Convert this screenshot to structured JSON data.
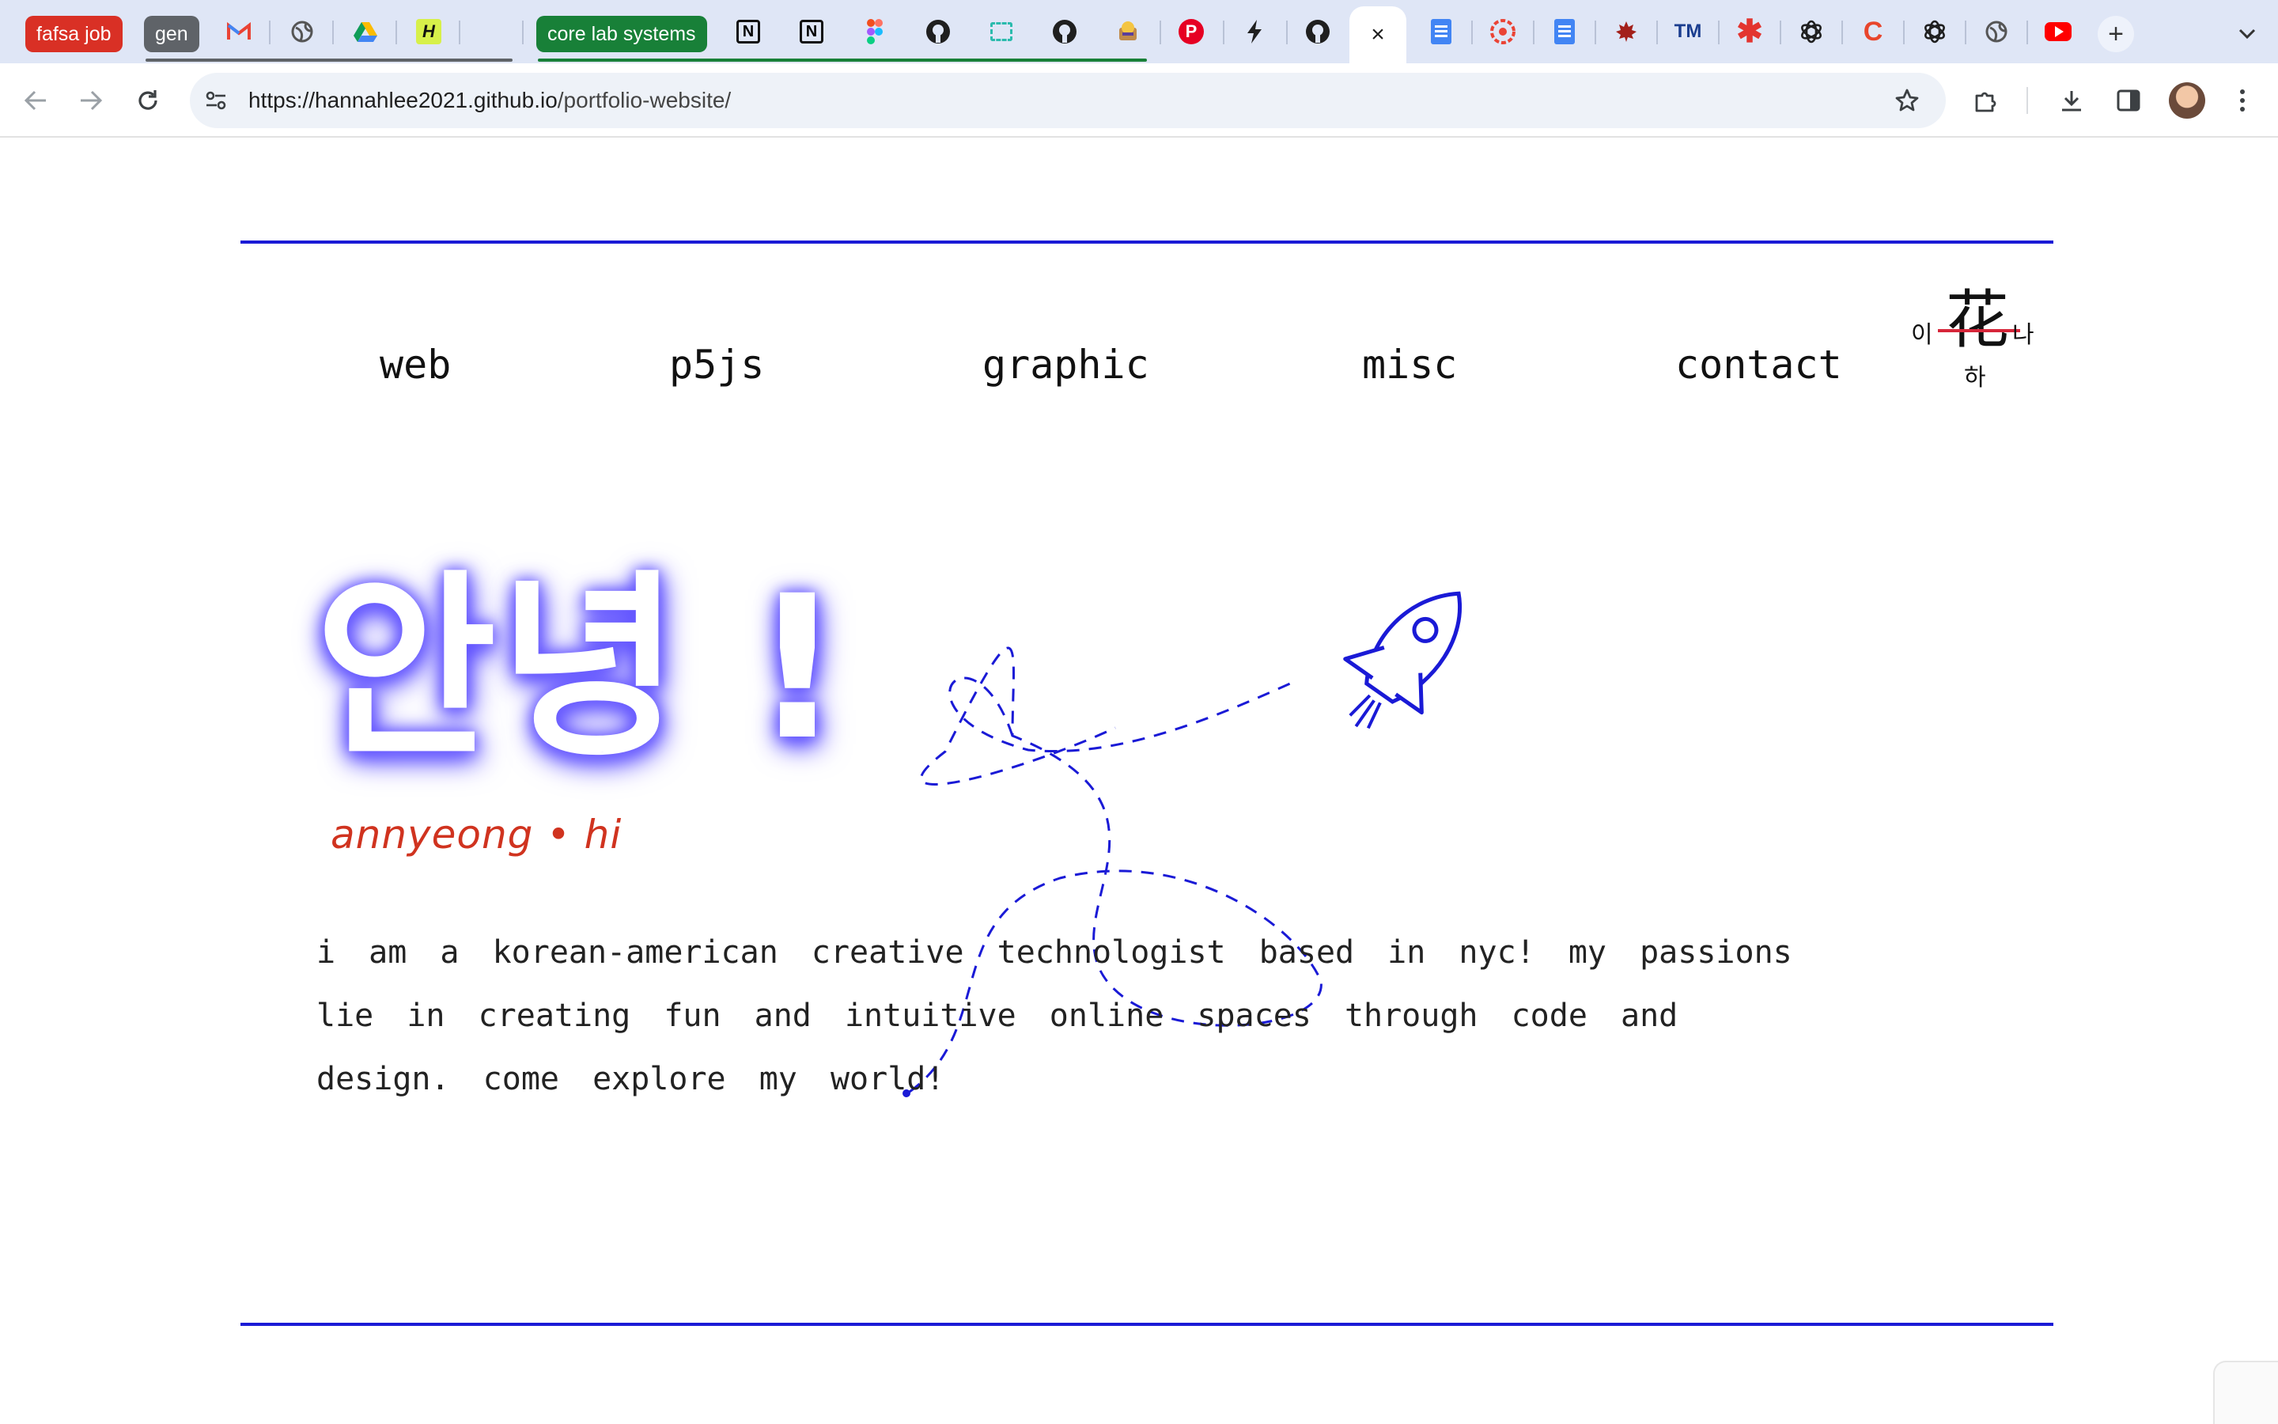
{
  "browser": {
    "tab_groups": [
      {
        "label": "fafsa job",
        "color": "#d93025"
      },
      {
        "label": "gen",
        "color": "#5f6368"
      },
      {
        "label": "core lab systems",
        "color": "#188038"
      }
    ],
    "tab_icons": [
      "gmail-icon",
      "globe-icon",
      "google-drive-icon",
      "hackernews-icon",
      "blank-tab-icon",
      "notion-icon",
      "notion-icon",
      "figma-icon",
      "github-icon",
      "square-dashed-icon",
      "github-icon",
      "emoji-icon",
      "pinterest-icon",
      "bolt-icon",
      "github-icon",
      "google-docs-icon",
      "target-icon",
      "google-docs-icon",
      "maple-leaf-icon",
      "tm-icon",
      "asterisk-icon",
      "openai-icon",
      "c-icon",
      "openai-icon",
      "globe-icon",
      "youtube-icon"
    ],
    "active_tab_close": "×",
    "new_tab": "+",
    "url_host": "https://hannahlee2021.github.io",
    "url_path": "/portfolio-website/"
  },
  "page": {
    "accent_color": "#1a1ad6",
    "nav": [
      "web",
      "p5js",
      "graphic",
      "misc",
      "contact"
    ],
    "logo": {
      "hanja": "花",
      "left": "이",
      "right": "나",
      "bottom": "하"
    },
    "hero_title": "안녕 !",
    "subtitle": "annyeong • hi",
    "bio": "i am a korean-american creative technologist based in nyc! my passions lie in creating fun and intuitive online spaces through code and design. come explore my world!"
  }
}
